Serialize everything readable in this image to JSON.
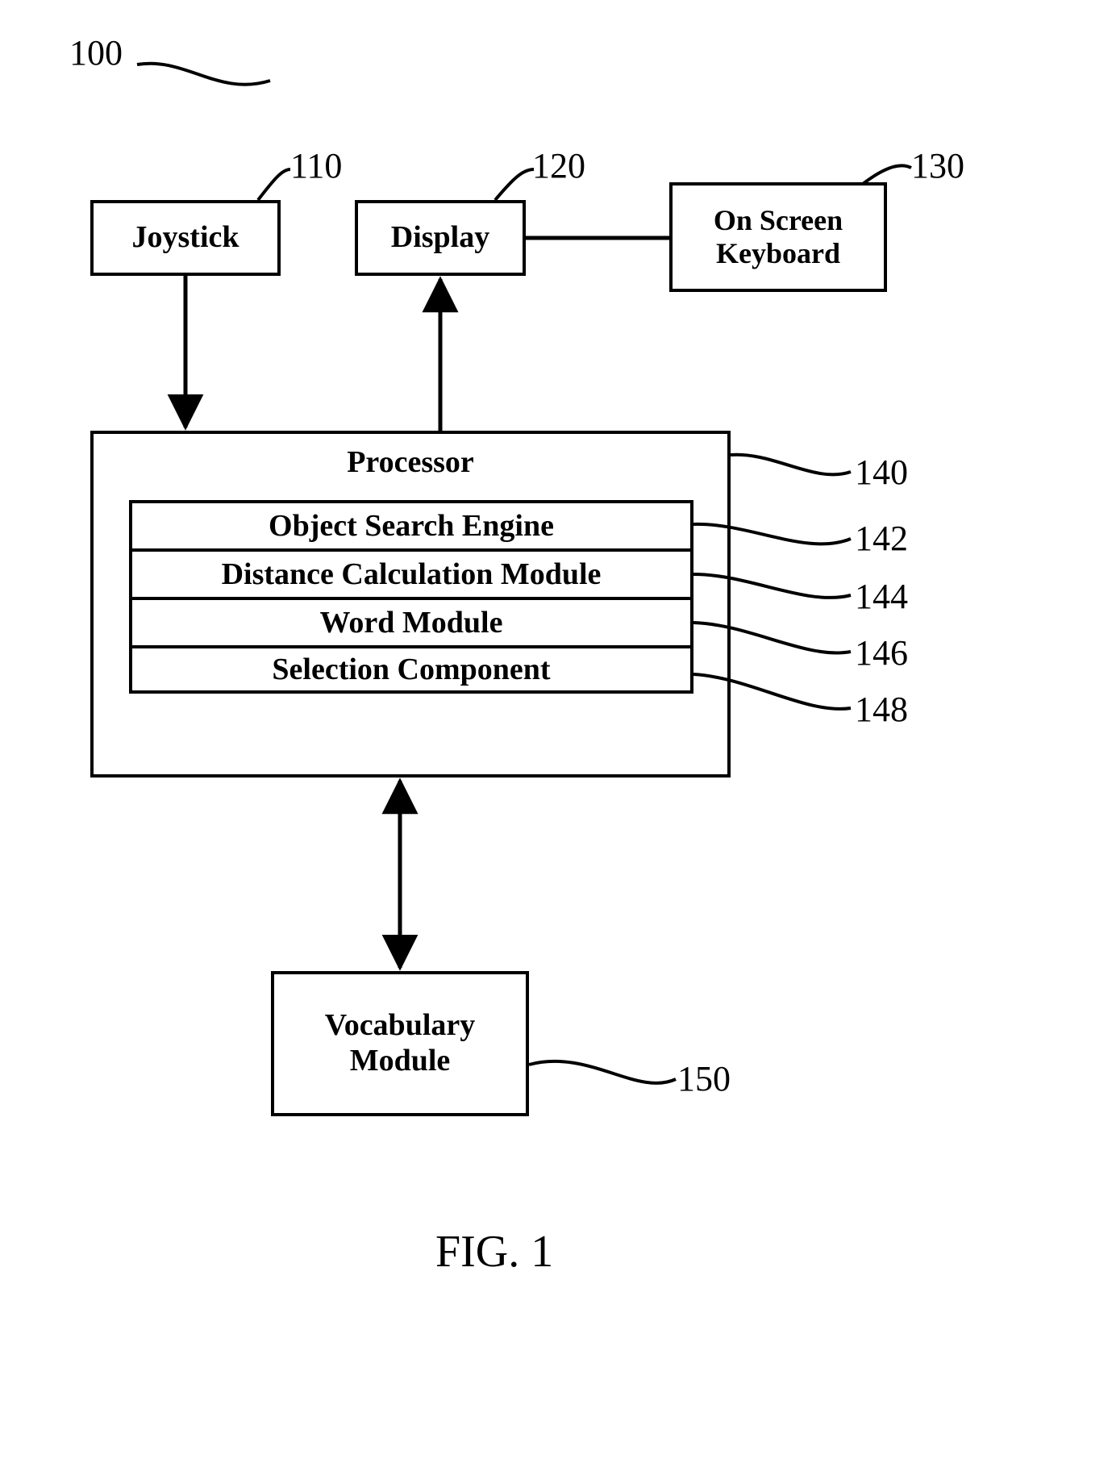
{
  "figure_ref": "100",
  "blocks": {
    "joystick": {
      "label": "Joystick",
      "ref": "110"
    },
    "display": {
      "label": "Display",
      "ref": "120"
    },
    "keyboard": {
      "label_line1": "On Screen",
      "label_line2": "Keyboard",
      "ref": "130"
    },
    "processor": {
      "label": "Processor",
      "ref": "140"
    },
    "engine": {
      "label": "Object Search Engine",
      "ref": "142"
    },
    "distance": {
      "label": "Distance Calculation Module",
      "ref": "144"
    },
    "word": {
      "label": "Word Module",
      "ref": "146"
    },
    "selection": {
      "label": "Selection Component",
      "ref": "148"
    },
    "vocab": {
      "label_line1": "Vocabulary",
      "label_line2": "Module",
      "ref": "150"
    }
  },
  "caption": "FIG. 1"
}
